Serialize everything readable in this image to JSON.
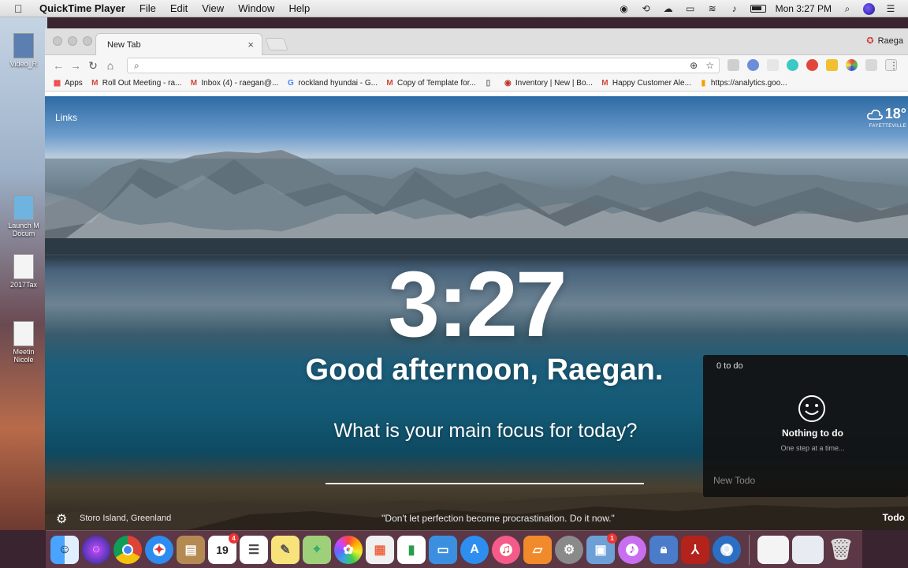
{
  "menubar": {
    "app_name": "QuickTime Player",
    "menus": [
      "File",
      "Edit",
      "View",
      "Window",
      "Help"
    ],
    "clock": "Mon 3:27 PM"
  },
  "desktop": {
    "items": [
      "Video_R",
      "Launch M Docum",
      "2017Tax",
      "Meetin Nicole"
    ]
  },
  "browser": {
    "tab_title": "New Tab",
    "tab_close": "×",
    "profile_name": "Raega",
    "omnibox_value": "",
    "bookmarks": [
      {
        "icon": "apps",
        "label": "Apps"
      },
      {
        "icon": "gmail",
        "label": "Roll Out Meeting - ra..."
      },
      {
        "icon": "gmail",
        "label": "Inbox (4) - raegan@..."
      },
      {
        "icon": "google",
        "label": "rockland hyundai - G..."
      },
      {
        "icon": "gmail",
        "label": "Copy of Template for..."
      },
      {
        "icon": "doc",
        "label": ""
      },
      {
        "icon": "circle",
        "label": "Inventory | New | Bo..."
      },
      {
        "icon": "gmail",
        "label": "Happy Customer Ale..."
      },
      {
        "icon": "analytics",
        "label": "https://analytics.goo..."
      }
    ]
  },
  "momentum": {
    "links_label": "Links",
    "weather_temp": "18°",
    "weather_location": "FAYETTEVILLE",
    "time": "3:27",
    "greeting": "Good afternoon, Raegan.",
    "focus_question": "What is your main focus for today?",
    "photo_location": "Storo Island, Greenland",
    "quote": "\"Don't let perfection become procrastination. Do it now.\"",
    "todo_label": "Todo"
  },
  "todo_panel": {
    "count": "0 to do",
    "empty_title": "Nothing to do",
    "empty_sub": "One step at a time...",
    "new_placeholder": "New Todo"
  },
  "dock": {
    "badges": {
      "calendar_day": "19",
      "calendar_badge": "4",
      "app_store_badge": "1"
    }
  },
  "colors": {
    "accent_weather": "#ffffff",
    "todo_bg": "#121212",
    "dock_bg": "#5f3a48"
  }
}
